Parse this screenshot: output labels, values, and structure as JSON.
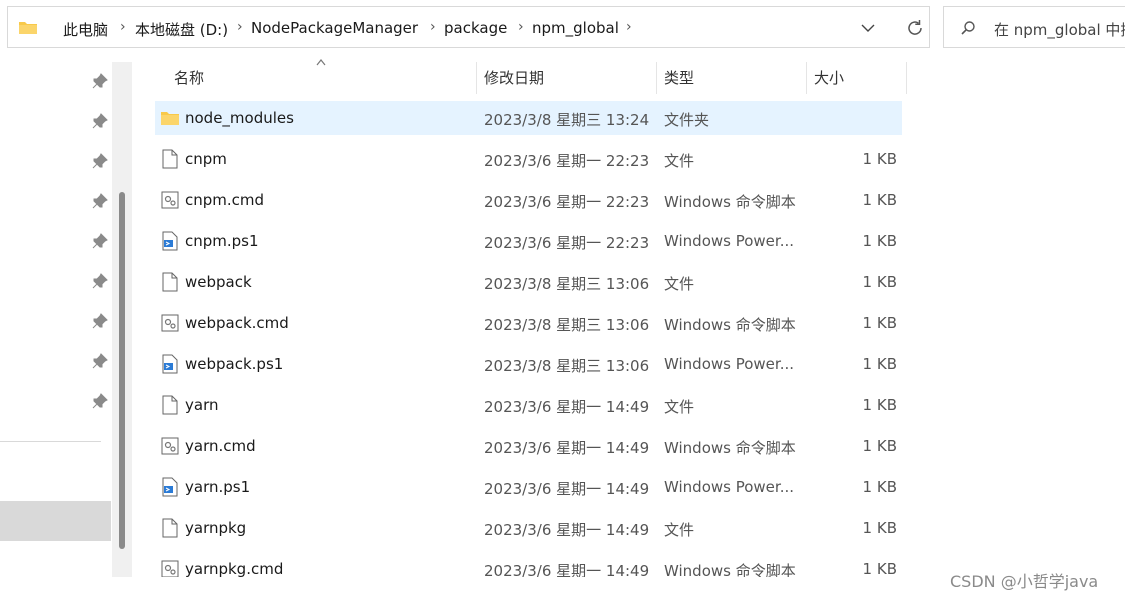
{
  "address_bar": {
    "breadcrumbs": [
      "此电脑",
      "本地磁盘 (D:)",
      "NodePackageManager",
      "package",
      "npm_global"
    ],
    "folder_icon": "folder-icon",
    "dropdown_icon": "chevron-down-icon",
    "refresh_icon": "refresh-icon"
  },
  "search": {
    "placeholder": "在 npm_global 中搜"
  },
  "columns": {
    "name": "名称",
    "date": "修改日期",
    "type": "类型",
    "size": "大小"
  },
  "files": [
    {
      "name": "node_modules",
      "date": "2023/3/8 星期三 13:24",
      "type": "文件夹",
      "size": "",
      "icon": "folder-icon",
      "selected": true
    },
    {
      "name": "cnpm",
      "date": "2023/3/6 星期一 22:23",
      "type": "文件",
      "size": "1 KB",
      "icon": "file-icon"
    },
    {
      "name": "cnpm.cmd",
      "date": "2023/3/6 星期一 22:23",
      "type": "Windows 命令脚本",
      "size": "1 KB",
      "icon": "cmd-file-icon"
    },
    {
      "name": "cnpm.ps1",
      "date": "2023/3/6 星期一 22:23",
      "type": "Windows Power...",
      "size": "1 KB",
      "icon": "ps1-file-icon"
    },
    {
      "name": "webpack",
      "date": "2023/3/8 星期三 13:06",
      "type": "文件",
      "size": "1 KB",
      "icon": "file-icon"
    },
    {
      "name": "webpack.cmd",
      "date": "2023/3/8 星期三 13:06",
      "type": "Windows 命令脚本",
      "size": "1 KB",
      "icon": "cmd-file-icon"
    },
    {
      "name": "webpack.ps1",
      "date": "2023/3/8 星期三 13:06",
      "type": "Windows Power...",
      "size": "1 KB",
      "icon": "ps1-file-icon"
    },
    {
      "name": "yarn",
      "date": "2023/3/6 星期一 14:49",
      "type": "文件",
      "size": "1 KB",
      "icon": "file-icon"
    },
    {
      "name": "yarn.cmd",
      "date": "2023/3/6 星期一 14:49",
      "type": "Windows 命令脚本",
      "size": "1 KB",
      "icon": "cmd-file-icon"
    },
    {
      "name": "yarn.ps1",
      "date": "2023/3/6 星期一 14:49",
      "type": "Windows Power...",
      "size": "1 KB",
      "icon": "ps1-file-icon"
    },
    {
      "name": "yarnpkg",
      "date": "2023/3/6 星期一 14:49",
      "type": "文件",
      "size": "1 KB",
      "icon": "file-icon"
    },
    {
      "name": "yarnpkg.cmd",
      "date": "2023/3/6 星期一 14:49",
      "type": "Windows 命令脚本",
      "size": "1 KB",
      "icon": "cmd-file-icon"
    }
  ],
  "watermark": "CSDN @小哲学java",
  "colors": {
    "selected_row": "#e5f3ff",
    "nav_selected": "#d9d9d9",
    "folder_yellow": "#f8c94a"
  }
}
